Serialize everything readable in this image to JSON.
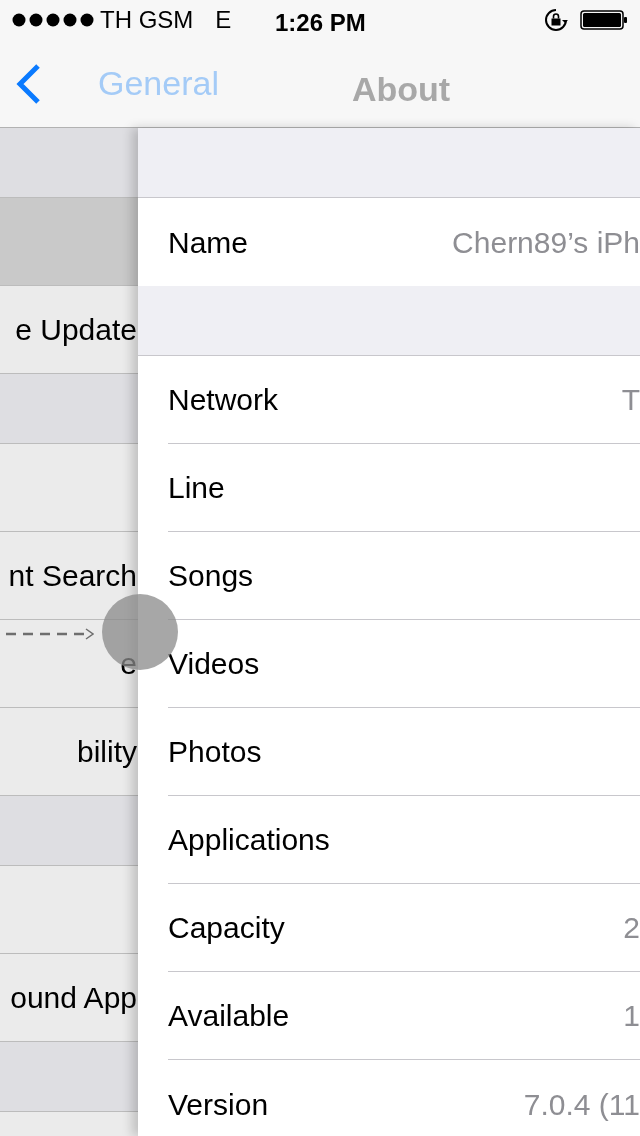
{
  "status_bar": {
    "carrier": "TH GSM",
    "network": "E",
    "time": "1:26 PM"
  },
  "nav_bar": {
    "previous_title": "General",
    "title": "About"
  },
  "background_list": [
    {
      "kind": "header"
    },
    {
      "kind": "cell",
      "selected": true
    },
    {
      "kind": "cell",
      "label": "e Update",
      "selected": false
    },
    {
      "kind": "header"
    },
    {
      "kind": "cell",
      "selected": false
    },
    {
      "kind": "cell",
      "label": "nt Search",
      "selected": false
    },
    {
      "kind": "cell",
      "label": "e",
      "selected": false
    },
    {
      "kind": "cell",
      "label": "bility",
      "selected": false
    },
    {
      "kind": "header"
    },
    {
      "kind": "cell",
      "selected": false
    },
    {
      "kind": "cell",
      "label": "ound App",
      "selected": false
    },
    {
      "kind": "header"
    },
    {
      "kind": "cell",
      "selected": false
    }
  ],
  "about_list": [
    {
      "kind": "header"
    },
    {
      "kind": "row",
      "label": "Name",
      "value": "Chern89’s iPh"
    },
    {
      "kind": "header"
    },
    {
      "kind": "row",
      "label": "Network",
      "value": "T"
    },
    {
      "kind": "row",
      "label": "Line"
    },
    {
      "kind": "row",
      "label": "Songs"
    },
    {
      "kind": "row",
      "label": "Videos"
    },
    {
      "kind": "row",
      "label": "Photos"
    },
    {
      "kind": "row",
      "label": "Applications"
    },
    {
      "kind": "row",
      "label": "Capacity",
      "value": "2"
    },
    {
      "kind": "row",
      "label": "Available",
      "value": "1"
    },
    {
      "kind": "row",
      "label": "Version",
      "value": "7.0.4 (11"
    }
  ]
}
